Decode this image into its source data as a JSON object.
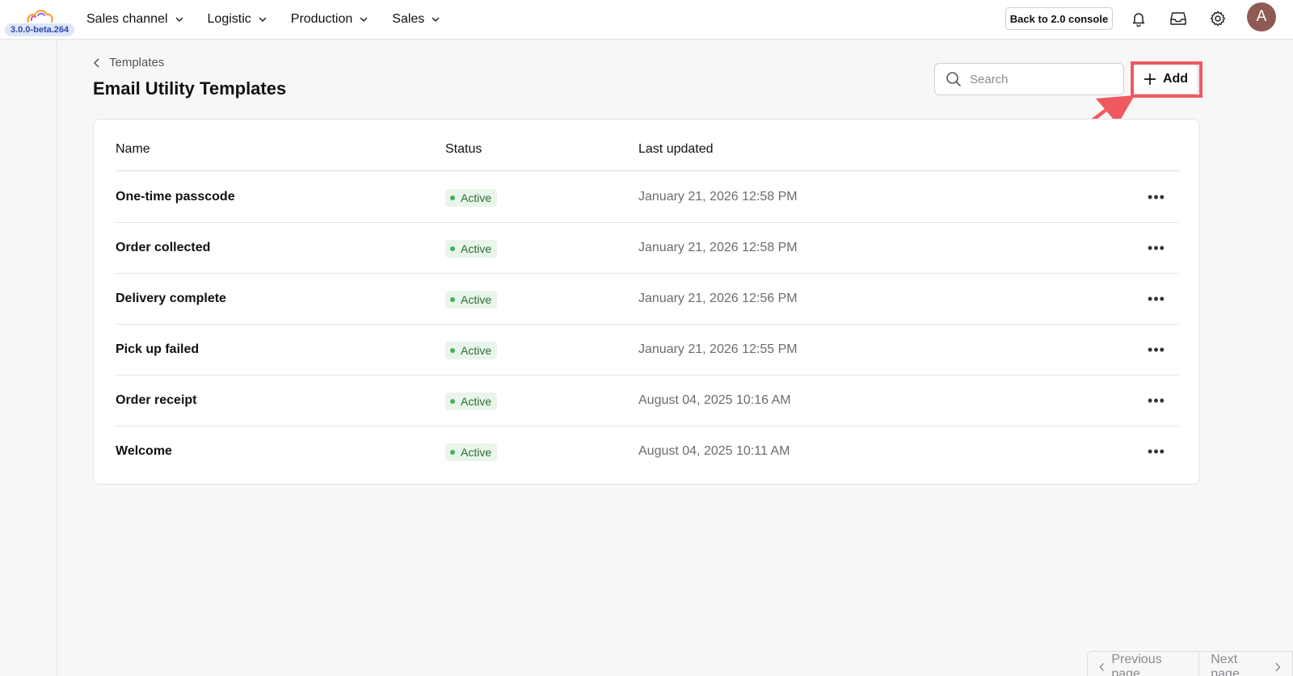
{
  "app": {
    "version": "3.0.0-beta.264"
  },
  "nav": {
    "items": [
      {
        "label": "Sales channel"
      },
      {
        "label": "Logistic"
      },
      {
        "label": "Production"
      },
      {
        "label": "Sales"
      }
    ]
  },
  "topbar": {
    "back_label": "Back to 2.0 console",
    "avatar_initial": "A"
  },
  "breadcrumb": {
    "parent": "Templates"
  },
  "page": {
    "title": "Email Utility Templates"
  },
  "search": {
    "placeholder": "Search",
    "value": ""
  },
  "toolbar": {
    "add_label": "Add",
    "highlight_color": "#ef5a61"
  },
  "table": {
    "columns": [
      "Name",
      "Status",
      "Last updated"
    ],
    "rows": [
      {
        "name": "One-time passcode",
        "status": "Active",
        "updated": "January 21, 2026 12:58 PM"
      },
      {
        "name": "Order collected",
        "status": "Active",
        "updated": "January 21, 2026 12:58 PM"
      },
      {
        "name": "Delivery complete",
        "status": "Active",
        "updated": "January 21, 2026 12:56 PM"
      },
      {
        "name": "Pick up failed",
        "status": "Active",
        "updated": "January 21, 2026 12:55 PM"
      },
      {
        "name": "Order receipt",
        "status": "Active",
        "updated": "August 04, 2025 10:16 AM"
      },
      {
        "name": "Welcome",
        "status": "Active",
        "updated": "August 04, 2025 10:11 AM"
      }
    ]
  },
  "pagination": {
    "prev_label": "Previous page",
    "next_label": "Next page"
  },
  "colors": {
    "status_active_bg": "#e9f5ea",
    "status_active_dot": "#43b05a",
    "avatar_bg": "#8f5a54"
  },
  "icons": [
    "logo-icon",
    "chevron-down-icon",
    "bell-icon",
    "inbox-icon",
    "gear-icon",
    "chevron-left-icon",
    "search-icon",
    "plus-icon",
    "more-icon",
    "chevron-right-icon"
  ]
}
